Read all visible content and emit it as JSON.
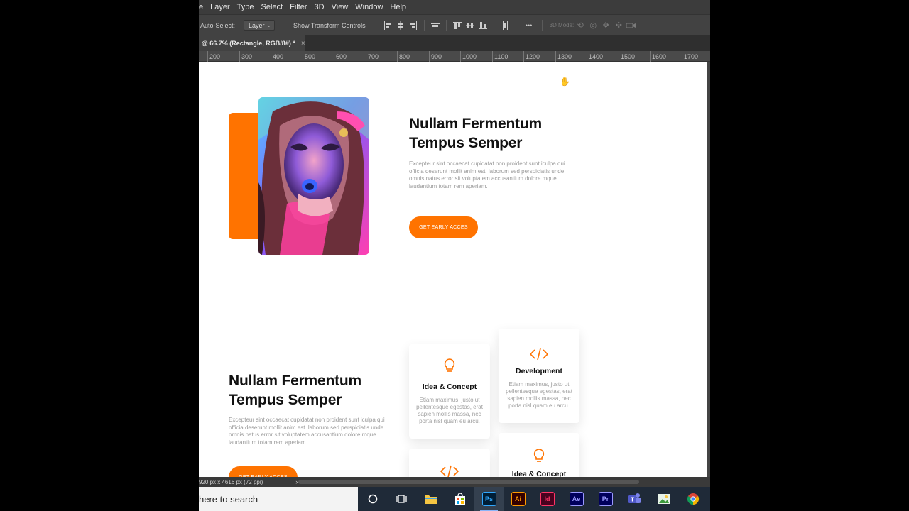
{
  "menu": [
    "e",
    "Layer",
    "Type",
    "Select",
    "Filter",
    "3D",
    "View",
    "Window",
    "Help"
  ],
  "options": {
    "auto_select_label": "Auto-Select:",
    "auto_select_value": "Layer",
    "show_transform_label": "Show Transform Controls",
    "mode_3d_label": "3D Mode:",
    "more_label": "•••"
  },
  "document_tab": {
    "title": "@ 66.7% (Rectangle, RGB/8#) *",
    "close": "×"
  },
  "ruler_ticks": [
    "200",
    "300",
    "400",
    "500",
    "600",
    "700",
    "800",
    "900",
    "1000",
    "1100",
    "1200",
    "1300",
    "1400",
    "1500",
    "1600",
    "1700"
  ],
  "canvas": {
    "hero": {
      "title_line1": "Nullam Fermentum",
      "title_line2": "Tempus Semper",
      "paragraph": "Excepteur sint occaecat cupidatat non proident sunt iculpa qui officia deserunt mollit anim est. laborum sed perspiciatis unde omnis natus error sit voluptatem accusantium dolore mque laudantium totam rem aperiam.",
      "cta": "GET EARLY ACCES"
    },
    "section2": {
      "title_line1": "Nullam Fermentum",
      "title_line2": "Tempus Semper",
      "paragraph": "Excepteur sint occaecat cupidatat non proident sunt iculpa qui officia deserunt mollit anim est. laborum sed perspiciatis unde omnis natus error sit voluptatem accusantium dolore mque laudantium totam rem aperiam.",
      "cta": "GET EARLY ACCES"
    },
    "cards": [
      {
        "icon": "lightbulb-icon",
        "title": "Idea & Concept",
        "desc": "Etiam maximus, justo ut pellentesque egestas, erat sapien mollis massa, nec porta nisl quam eu arcu."
      },
      {
        "icon": "code-icon",
        "title": "Development",
        "desc": "Etiam maximus, justo ut pellentesque egestas, erat sapien mollis massa, nec porta nisl quam eu arcu."
      },
      {
        "icon": "code-icon",
        "title": "",
        "desc": ""
      },
      {
        "icon": "lightbulb-icon",
        "title": "Idea & Concept",
        "desc": ""
      }
    ],
    "accent_color": "#ff7300"
  },
  "status": {
    "size_text": "920 px x 4616 px (72 ppi)"
  },
  "taskbar": {
    "search_text": "here to search",
    "apps": [
      "Ai",
      "Id",
      "Ae",
      "Pr"
    ]
  }
}
